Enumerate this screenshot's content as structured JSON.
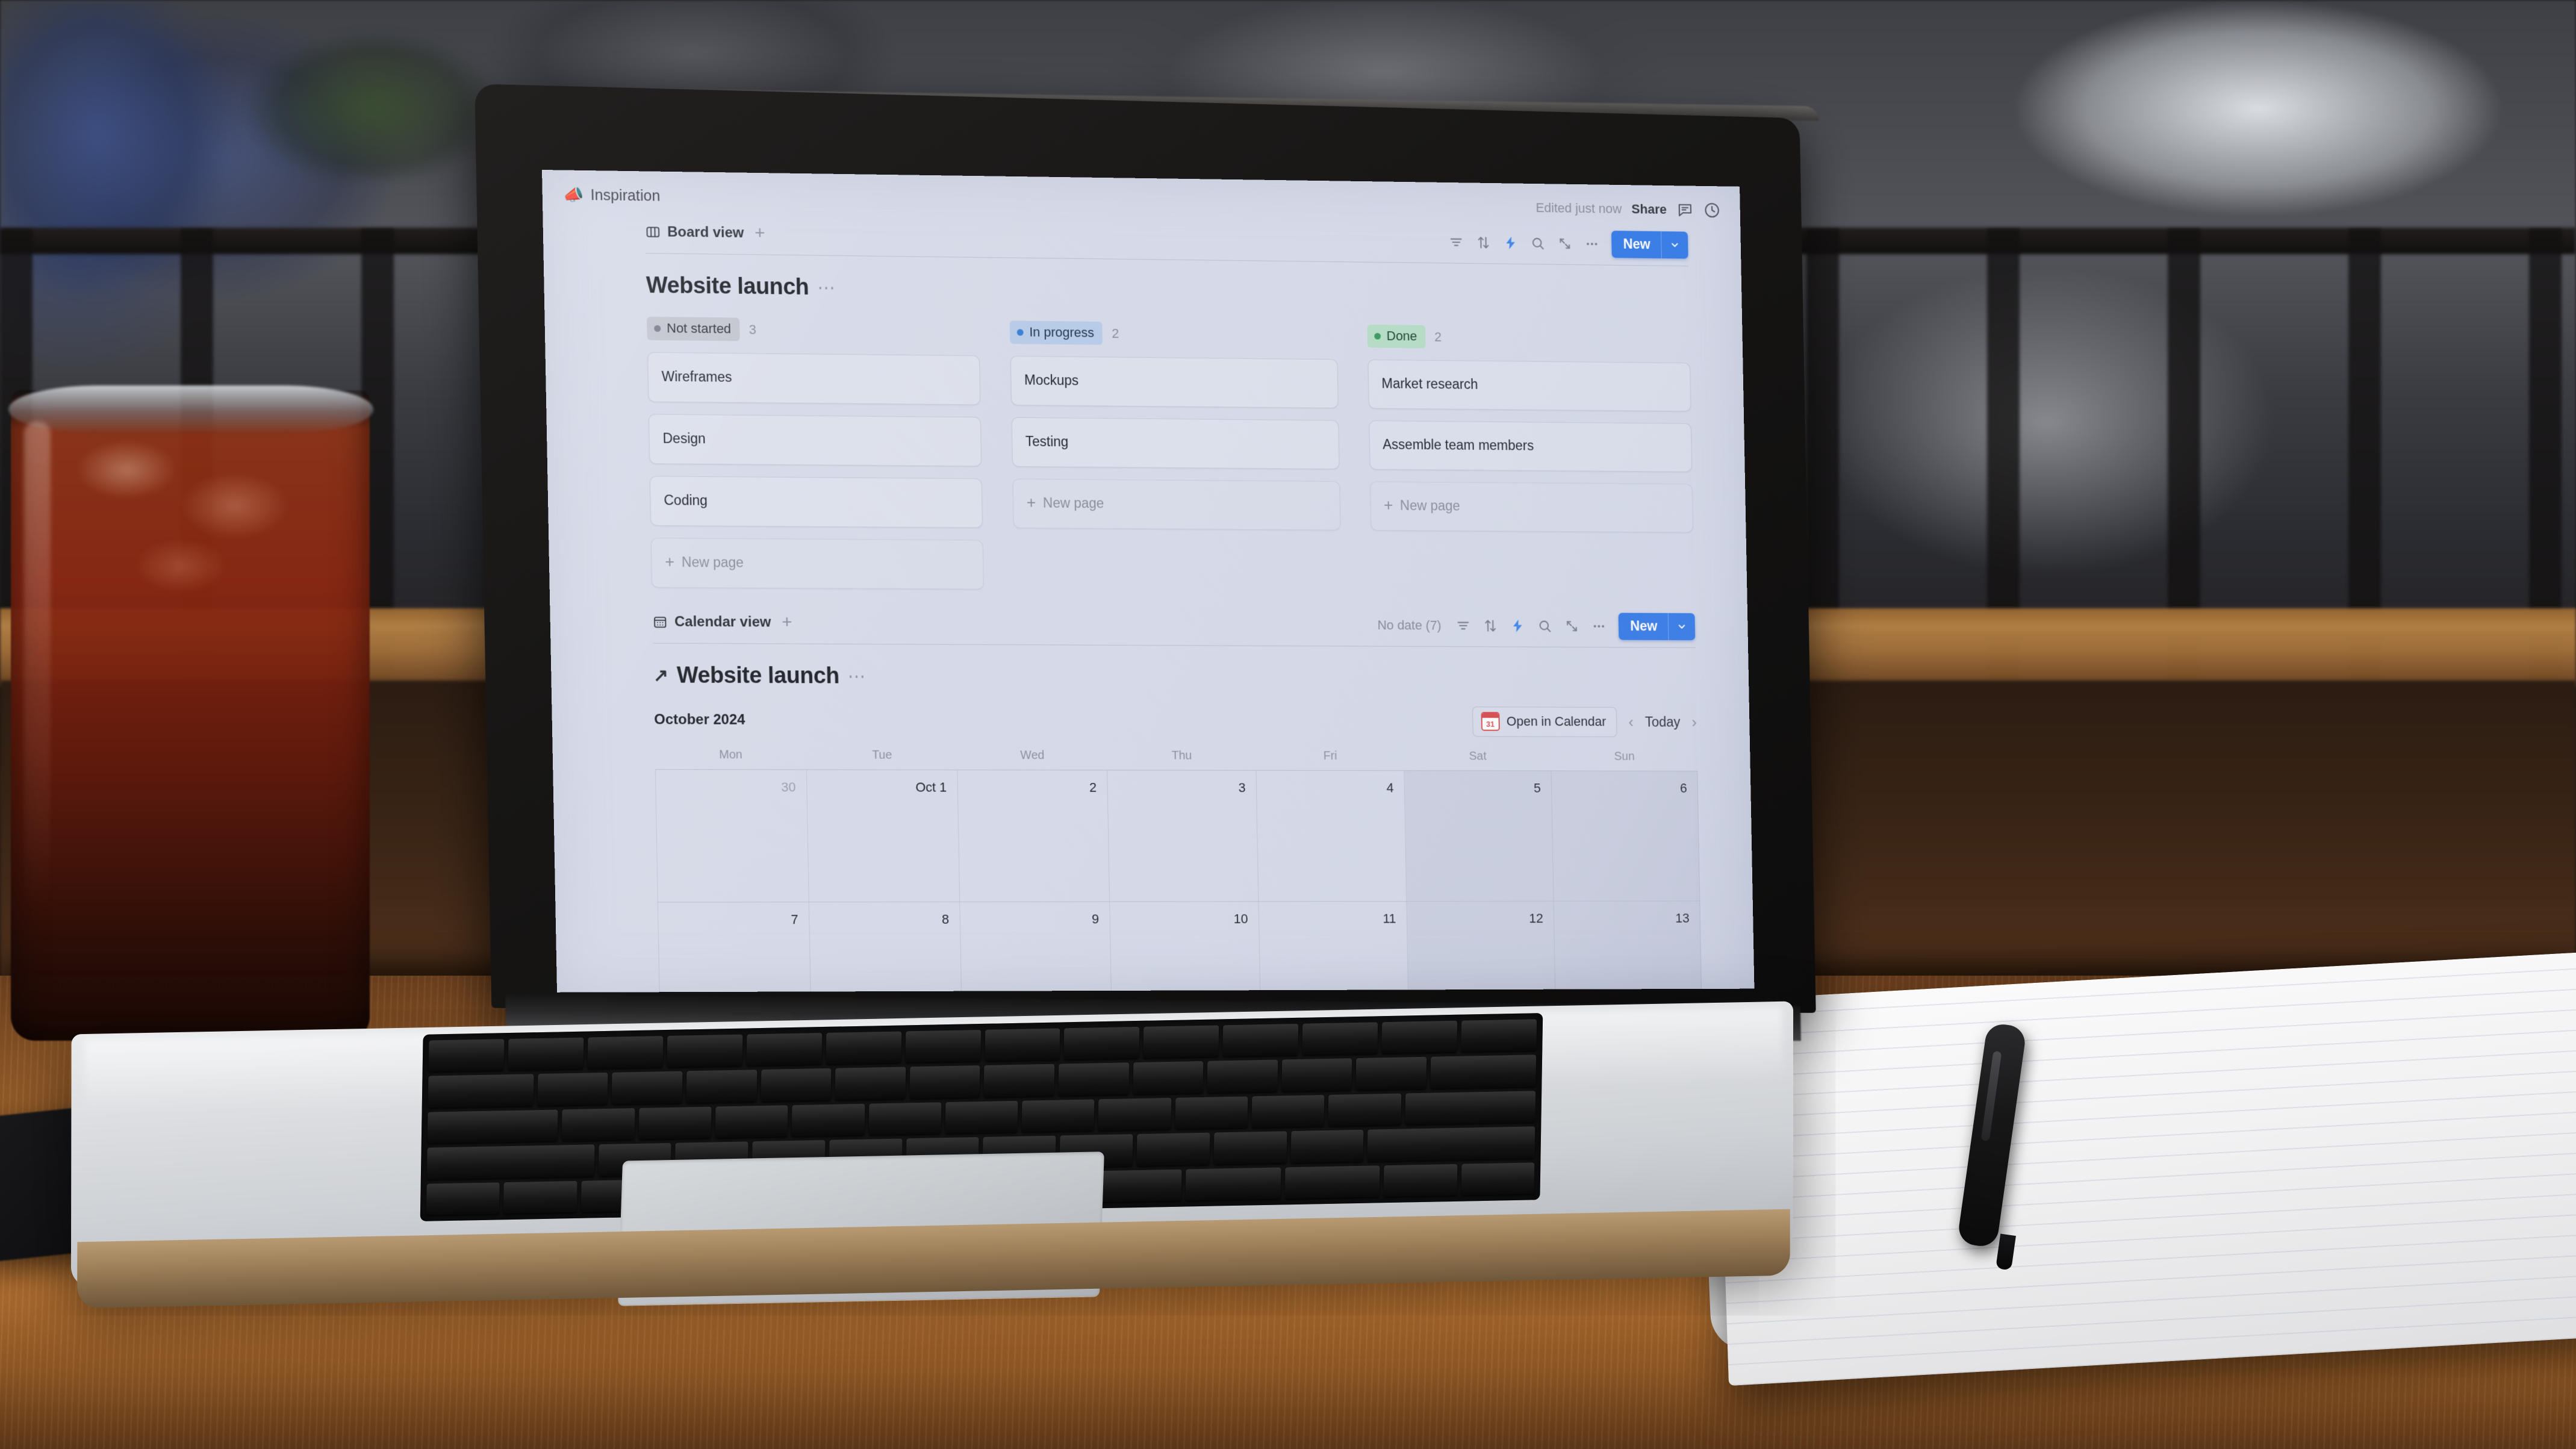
{
  "scene": {
    "description": "Laptop on a wooden cafe table showing a Notion workspace, with an iced drink at left and an open notebook with pen at right"
  },
  "app": {
    "breadcrumb": {
      "emoji": "📣",
      "emoji_name": "megaphone-emoji",
      "label": "Inspiration"
    },
    "header": {
      "edited_status": "Edited just now",
      "share_label": "Share",
      "icons": [
        "comment-icon",
        "history-clock-icon"
      ]
    },
    "accent_color": "#337ae8"
  },
  "board_view": {
    "tab_label": "Board view",
    "tab_icon": "board-columns-icon",
    "add_view_label": "+",
    "toolbar_icons": [
      "filter-icon",
      "sort-icon",
      "automation-lightning-icon",
      "search-icon",
      "expand-icon",
      "more-options-icon"
    ],
    "new_button": {
      "label": "New",
      "chevron": "chevron-down-icon"
    },
    "database_title": "Website launch",
    "title_menu": "⋯",
    "columns": [
      {
        "status": "Not started",
        "count": "3",
        "pill_bg": "#c3c6cf",
        "pill_text": "#33373e",
        "dot_color": "#7d8190",
        "cards": [
          "Wireframes",
          "Design",
          "Coding"
        ],
        "new_page_label": "New page"
      },
      {
        "status": "In progress",
        "count": "2",
        "pill_bg": "#b7cbe8",
        "pill_text": "#23384f",
        "dot_color": "#3b7fd4",
        "cards": [
          "Mockups",
          "Testing"
        ],
        "new_page_label": "New page"
      },
      {
        "status": "Done",
        "count": "2",
        "pill_bg": "#b6ddc6",
        "pill_text": "#22452f",
        "dot_color": "#3d9a62",
        "cards": [
          "Market research",
          "Assemble team members"
        ],
        "new_page_label": "New page"
      }
    ]
  },
  "calendar_view": {
    "tab_label": "Calendar view",
    "tab_icon": "calendar-icon",
    "add_view_label": "+",
    "no_date_label": "No date (7)",
    "toolbar_icons": [
      "filter-icon",
      "sort-icon",
      "automation-lightning-icon",
      "search-icon",
      "expand-icon",
      "more-options-icon"
    ],
    "new_button": {
      "label": "New",
      "chevron": "chevron-down-icon"
    },
    "database_title": "Website launch",
    "title_arrow": "↗",
    "title_menu": "⋯",
    "month_label": "October 2024",
    "open_in_calendar_label": "Open in Calendar",
    "calendar_icon_number": "31",
    "prev_label": "‹",
    "today_label": "Today",
    "next_label": "›",
    "day_headers": [
      "Mon",
      "Tue",
      "Wed",
      "Thu",
      "Fri",
      "Sat",
      "Sun"
    ],
    "weeks": [
      [
        {
          "num": "30",
          "dim": true,
          "weekend": false
        },
        {
          "num": "Oct 1",
          "dim": false,
          "weekend": false
        },
        {
          "num": "2",
          "dim": false,
          "weekend": false
        },
        {
          "num": "3",
          "dim": false,
          "weekend": false
        },
        {
          "num": "4",
          "dim": false,
          "weekend": false
        },
        {
          "num": "5",
          "dim": false,
          "weekend": true
        },
        {
          "num": "6",
          "dim": false,
          "weekend": true
        }
      ],
      [
        {
          "num": "7",
          "dim": false,
          "weekend": false
        },
        {
          "num": "8",
          "dim": false,
          "weekend": false
        },
        {
          "num": "9",
          "dim": false,
          "weekend": false
        },
        {
          "num": "10",
          "dim": false,
          "weekend": false
        },
        {
          "num": "11",
          "dim": false,
          "weekend": false
        },
        {
          "num": "12",
          "dim": false,
          "weekend": true
        },
        {
          "num": "13",
          "dim": false,
          "weekend": true
        }
      ]
    ]
  }
}
